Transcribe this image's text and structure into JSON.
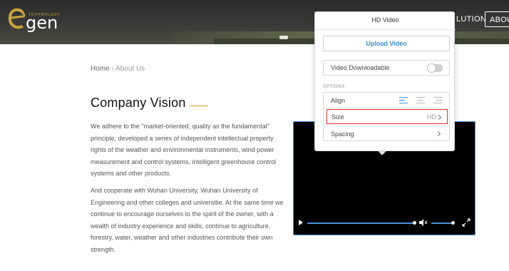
{
  "header": {
    "logo_text": "gen",
    "logo_tagline": "TECHNOLOGY",
    "nav": [
      {
        "label": "LUTION"
      },
      {
        "label": "ABOUT"
      }
    ]
  },
  "breadcrumb": {
    "home": "Home",
    "separator": "›",
    "current": "About Us"
  },
  "main": {
    "title": "Company Vision",
    "paragraph1": "We adhere to the \"market-oriented, quality as the fundamental\" principle, developed a series of independent intellectual property rights of the weather and environmental instruments, wind power measurement and control systems, intelligent greenhouse control systems and other products.",
    "paragraph2": "And cooperate with Wuhan University, Wuhan University of Engineering and other colleges and universitie. At the same time we continue to encourage ourselves to the spirit of the owner, with a wealth of industry experience and skills, continue to agriculture, forestry, water, weather and other industries contribute their own strength."
  },
  "video_player": {
    "icons": [
      "play-icon",
      "volume-icon",
      "fullscreen-icon"
    ],
    "progress": 0.98,
    "volume": 0.9
  },
  "popup": {
    "title": "HD Video",
    "upload_label": "Upload Video",
    "downloadable_label": "Video Downloadable",
    "downloadable_on": false,
    "options_header": "OPTIONS",
    "align_label": "Align",
    "align_selected": "left",
    "size_label": "Size",
    "size_value": "HD",
    "spacing_label": "Spacing"
  },
  "colors": {
    "accent": "#3a8fd8",
    "highlight": "#d9322f",
    "title_underline": "#d4a017",
    "logo_gold": "#c9a53c"
  }
}
